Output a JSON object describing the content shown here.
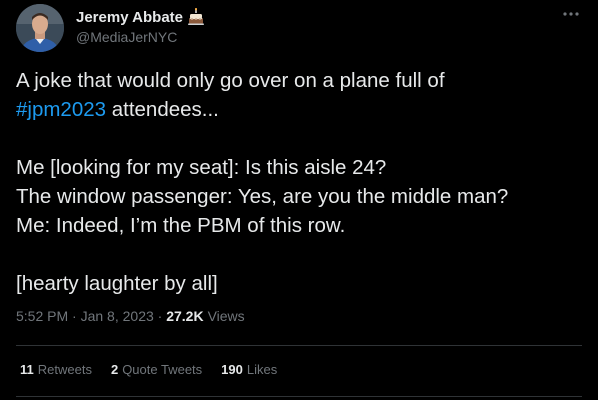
{
  "author": {
    "name": "Jeremy Abbate",
    "handle": "@MediaJerNYC",
    "badge_icon": "birthday-cake-icon"
  },
  "tweet": {
    "line1": "A joke that would only go over on a plane full of",
    "hashtag": "#jpm2023",
    "line2_rest": " attendees...",
    "line3": "Me [looking for my seat]: Is this aisle 24?",
    "line4": "The window passenger: Yes, are you the middle man?",
    "line5": "Me: Indeed, I’m the PBM of this row.",
    "line6": "[hearty laughter by all]"
  },
  "meta": {
    "time": "5:52 PM",
    "separator": " · ",
    "date": "Jan 8, 2023",
    "views_count": "27.2K",
    "views_label": "Views"
  },
  "stats": {
    "retweets_count": "11",
    "retweets_label": "Retweets",
    "quotes_count": "2",
    "quotes_label": "Quote Tweets",
    "likes_count": "190",
    "likes_label": "Likes"
  },
  "colors": {
    "background": "#000000",
    "text": "#e7e9ea",
    "secondary": "#71767b",
    "accent": "#1d9bf0",
    "divider": "#2f3336"
  }
}
